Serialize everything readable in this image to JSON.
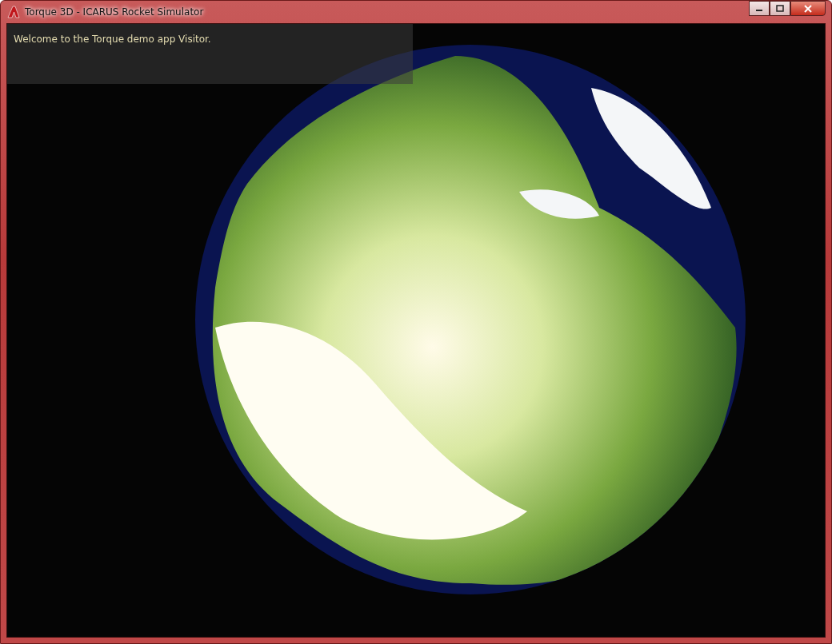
{
  "window": {
    "title": "Torque 3D - ICARUS Rocket Simulator"
  },
  "message_panel": {
    "text": "Welcome to the Torque demo app Visitor."
  }
}
